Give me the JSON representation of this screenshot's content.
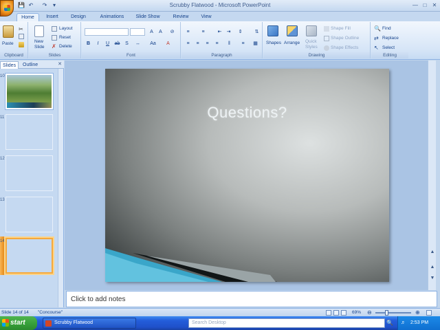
{
  "window": {
    "title": "Scrubby Flatwood - Microsoft PowerPoint",
    "qat_icons": [
      "save-icon",
      "undo-icon",
      "redo-icon"
    ],
    "controls": [
      "minimize",
      "maximize",
      "close"
    ]
  },
  "ribbon": {
    "tabs": [
      "Home",
      "Insert",
      "Design",
      "Animations",
      "Slide Show",
      "Review",
      "View"
    ],
    "active_tab": "Home",
    "clipboard": {
      "label": "Clipboard",
      "paste": "Paste"
    },
    "slides": {
      "label": "Slides",
      "new_slide": "New\nSlide",
      "layout": "Layout",
      "reset": "Reset",
      "delete": "Delete"
    },
    "font": {
      "label": "Font",
      "name_value": "",
      "size_value": ""
    },
    "paragraph": {
      "label": "Paragraph"
    },
    "drawing": {
      "label": "Drawing",
      "shapes": "Shapes",
      "arrange": "Arrange",
      "quick_styles": "Quick\nStyles",
      "shape_fill": "Shape Fill",
      "shape_outline": "Shape Outline",
      "shape_effects": "Shape Effects"
    },
    "editing": {
      "label": "Editing",
      "find": "Find",
      "replace": "Replace",
      "select": "Select"
    }
  },
  "pane": {
    "tabs": [
      "Slides",
      "Outline"
    ],
    "active_tab": "Slides",
    "slide_numbers": [
      "10",
      "11",
      "12",
      "13",
      "14"
    ],
    "selected_slide": "14"
  },
  "slide": {
    "title": "Questions?"
  },
  "notes": {
    "placeholder": "Click to add notes"
  },
  "status": {
    "slide_position": "Slide 14 of 14",
    "theme": "\"Concourse\"",
    "zoom": "69%"
  },
  "taskbar": {
    "start": "start",
    "task_item": "Scrubby Flatwood",
    "search_placeholder": "Search Desktop",
    "clock": "2:53 PM"
  },
  "colors": {
    "ribbon_text": "#15428b",
    "taskbar_blue": "#245edb",
    "start_green": "#38a23b",
    "selected_thumb": "#f6a93b"
  }
}
